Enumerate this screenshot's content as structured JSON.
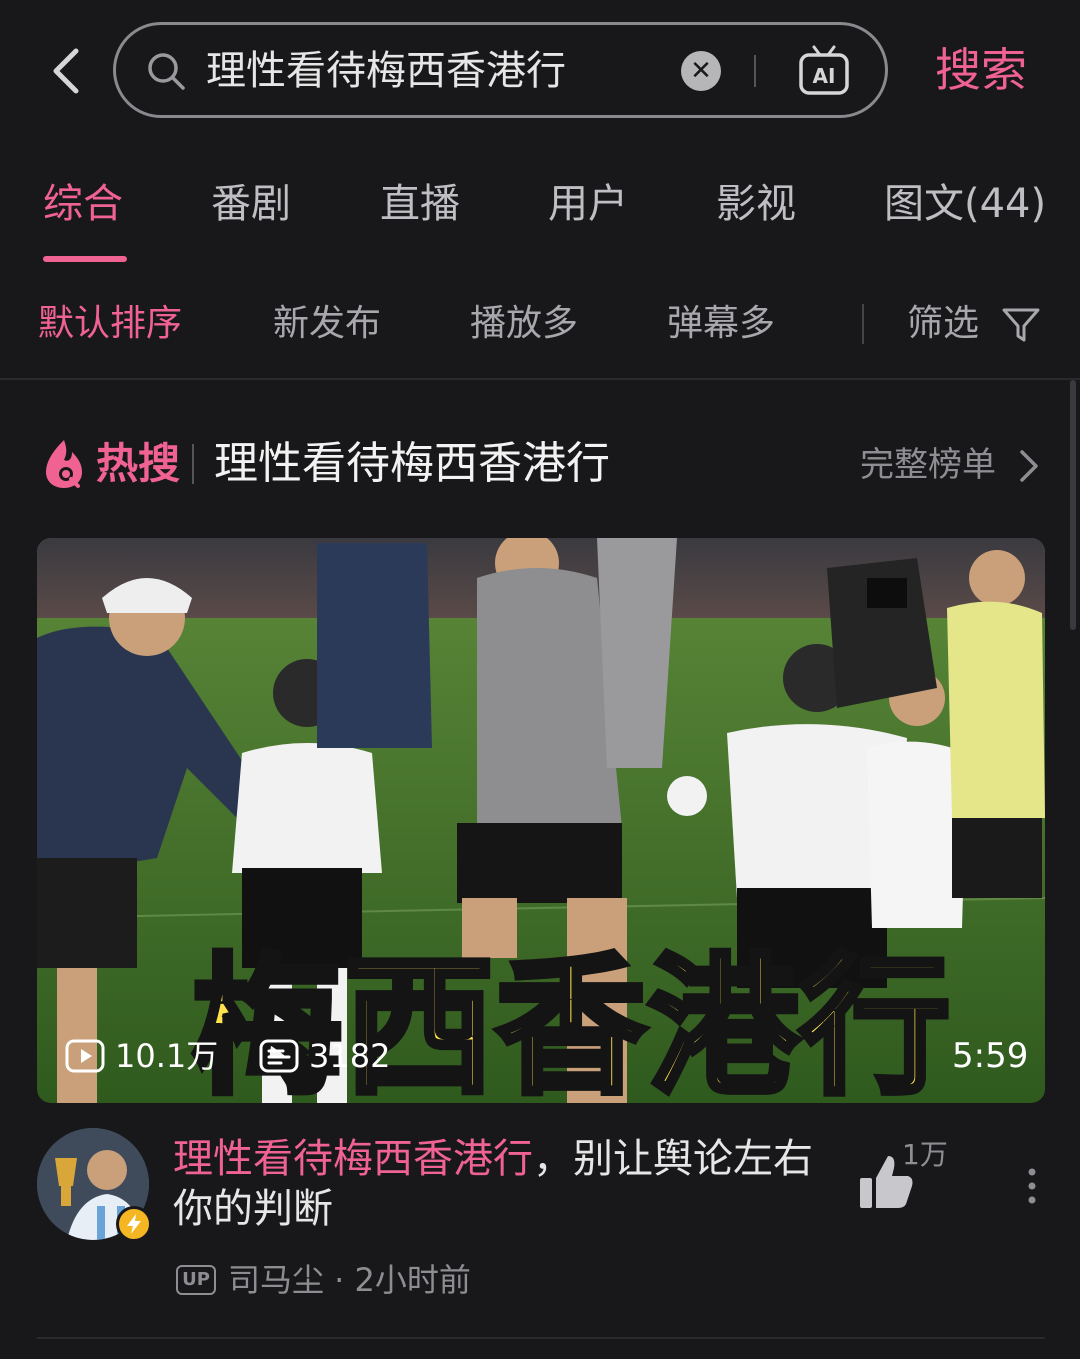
{
  "search": {
    "query": "理性看待梅西香港行",
    "submit_label": "搜索",
    "ai_label": "AI"
  },
  "tabs": [
    {
      "label": "综合",
      "active": true
    },
    {
      "label": "番剧"
    },
    {
      "label": "直播"
    },
    {
      "label": "用户"
    },
    {
      "label": "影视"
    },
    {
      "label": "图文(44)"
    }
  ],
  "sort": {
    "options": [
      "默认排序",
      "新发布",
      "播放多",
      "弹幕多"
    ],
    "active_index": 0,
    "filter_label": "筛选"
  },
  "hot": {
    "label": "热搜",
    "title": "理性看待梅西香港行",
    "full_list_label": "完整榜单"
  },
  "video": {
    "overlay_title": "梅西香港行",
    "views": "10.1万",
    "danmaku": "3182",
    "duration": "5:59",
    "title_highlight": "理性看待梅西香港行",
    "title_rest": "，别让舆论左右你的判断",
    "up_badge": "UP",
    "author_meta": "司马尘 · 2小时前",
    "likes": "1万"
  },
  "colors": {
    "accent": "#f06292",
    "background": "#18181b",
    "muted": "#8e8e92"
  }
}
